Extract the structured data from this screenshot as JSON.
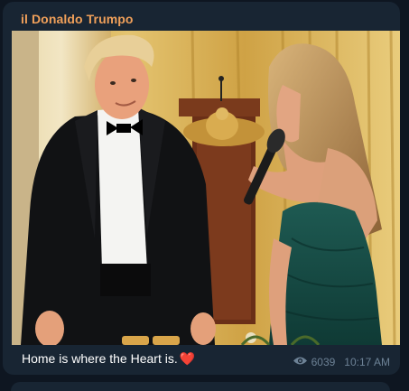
{
  "message": {
    "sender": "il Donaldo Trumpo",
    "caption": "Home is where the Heart is.",
    "caption_emoji": "❤️",
    "views": "6039",
    "time": "10:17 AM"
  },
  "icons": {
    "views_icon": "eye-icon"
  },
  "colors": {
    "background": "#0e1621",
    "bubble": "#182533",
    "sender_name": "#f0a05a",
    "meta_text": "#6d8296"
  }
}
